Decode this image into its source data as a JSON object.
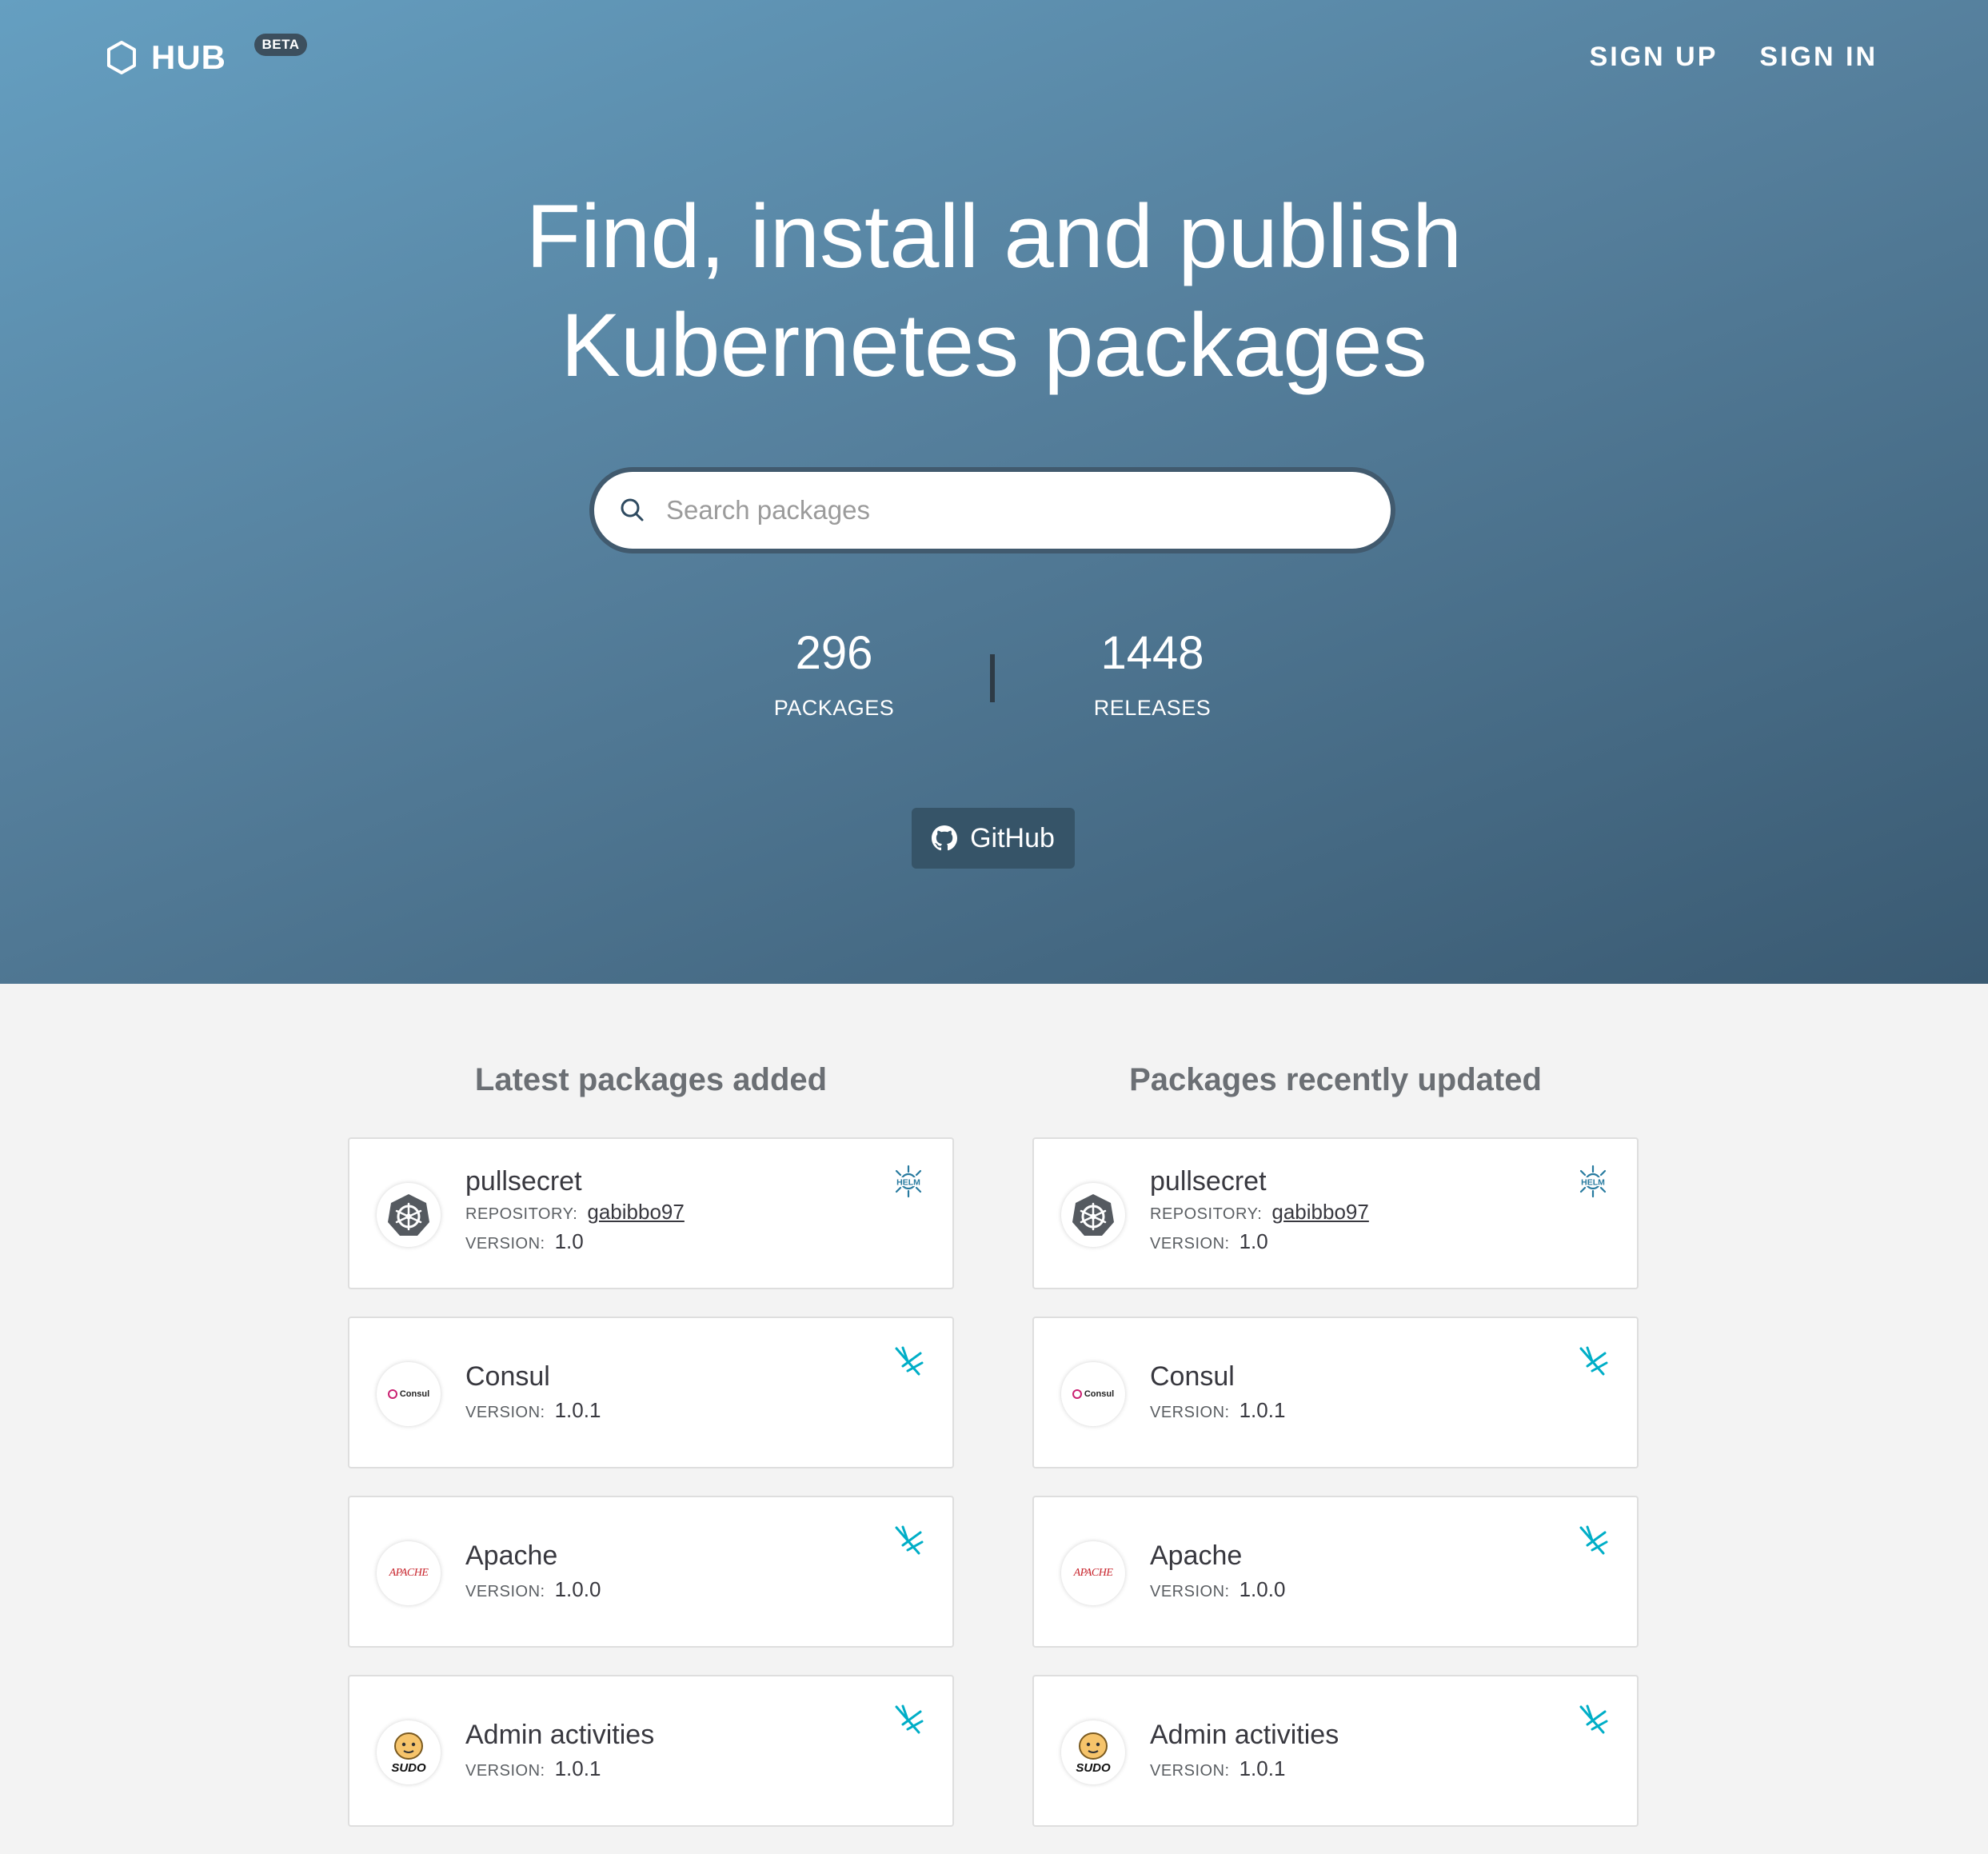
{
  "header": {
    "brand": "HUB",
    "badge": "BETA",
    "nav": [
      "SIGN UP",
      "SIGN IN"
    ]
  },
  "hero": {
    "title_line1": "Find, install and publish",
    "title_line2": "Kubernetes packages",
    "search_placeholder": "Search packages",
    "stats": {
      "packages_count": "296",
      "packages_label": "PACKAGES",
      "releases_count": "1448",
      "releases_label": "RELEASES"
    },
    "github_label": "GitHub"
  },
  "latest": {
    "title": "Latest packages added",
    "items": [
      {
        "name": "pullsecret",
        "repository_label": "REPOSITORY:",
        "repository": "gabibbo97",
        "version_label": "VERSION:",
        "version": "1.0",
        "logo": "kubernetes-icon",
        "kind": "helm-icon"
      },
      {
        "name": "Consul",
        "version_label": "VERSION:",
        "version": "1.0.1",
        "logo": "consul-logo",
        "kind": "falco-icon"
      },
      {
        "name": "Apache",
        "version_label": "VERSION:",
        "version": "1.0.0",
        "logo": "apache-logo",
        "kind": "falco-icon"
      },
      {
        "name": "Admin activities",
        "version_label": "VERSION:",
        "version": "1.0.1",
        "logo": "sudo-logo",
        "kind": "falco-icon"
      }
    ]
  },
  "updated": {
    "title": "Packages recently updated",
    "items": [
      {
        "name": "pullsecret",
        "repository_label": "REPOSITORY:",
        "repository": "gabibbo97",
        "version_label": "VERSION:",
        "version": "1.0",
        "logo": "kubernetes-icon",
        "kind": "helm-icon"
      },
      {
        "name": "Consul",
        "version_label": "VERSION:",
        "version": "1.0.1",
        "logo": "consul-logo",
        "kind": "falco-icon"
      },
      {
        "name": "Apache",
        "version_label": "VERSION:",
        "version": "1.0.0",
        "logo": "apache-logo",
        "kind": "falco-icon"
      },
      {
        "name": "Admin activities",
        "version_label": "VERSION:",
        "version": "1.0.1",
        "logo": "sudo-logo",
        "kind": "falco-icon"
      }
    ]
  },
  "logo_text": {
    "helm": "HELM",
    "consul": "Consul",
    "apache": "APACHE",
    "sudo": "SUDO"
  },
  "colors": {
    "hero_start": "#659fc1",
    "hero_end": "#3a5a72",
    "github_button": "#365468",
    "falco_accent": "#00aec7",
    "helm_accent": "#277a9f"
  }
}
